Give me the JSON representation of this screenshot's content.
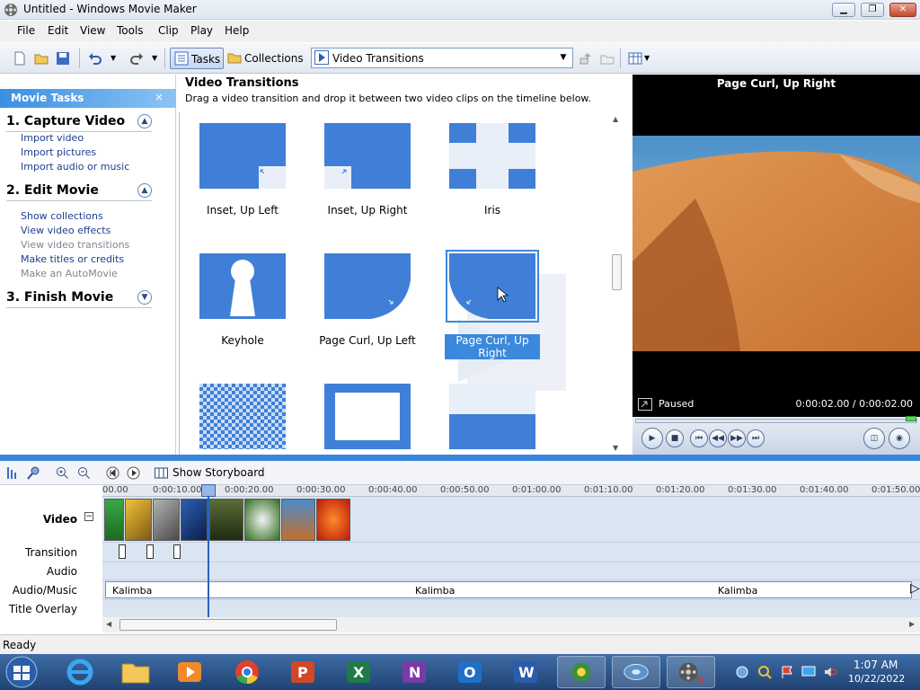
{
  "window": {
    "title": "Untitled - Windows Movie Maker"
  },
  "menu": [
    "File",
    "Edit",
    "View",
    "Tools",
    "Clip",
    "Play",
    "Help"
  ],
  "toolbar": {
    "tasks_label": "Tasks",
    "collections_label": "Collections",
    "collection_value": "Video Transitions"
  },
  "tasks_pane": {
    "header": "Movie Tasks",
    "close": "×",
    "sections": [
      {
        "title": "1. Capture Video",
        "links": [
          "Import video",
          "Import pictures",
          "Import audio or music"
        ]
      },
      {
        "title": "2. Edit Movie",
        "links": [
          "Show collections",
          "View video effects",
          "View video transitions",
          "Make titles or credits",
          "Make an AutoMovie"
        ]
      },
      {
        "title": "3. Finish Movie",
        "links": []
      }
    ]
  },
  "transitions": {
    "title": "Video Transitions",
    "description": "Drag a video transition and drop it between two video clips on the timeline below.",
    "items": [
      "Inset, Up Left",
      "Inset, Up Right",
      "Iris",
      "Keyhole",
      "Page Curl, Up Left",
      "Page Curl, Up Right"
    ],
    "selected": "Page Curl, Up Right"
  },
  "preview": {
    "title": "Page Curl, Up Right",
    "status": "Paused",
    "time": "0:00:02.00 / 0:00:02.00"
  },
  "timeline": {
    "show_storyboard": "Show Storyboard",
    "ruler_ticks": [
      "00.00",
      "0:00:10.00",
      "0:00:20.00",
      "0:00:30.00",
      "0:00:40.00",
      "0:00:50.00",
      "0:01:00.00",
      "0:01:10.00",
      "0:01:20.00",
      "0:01:30.00",
      "0:01:40.00",
      "0:01:50.00"
    ],
    "tracks": [
      "Video",
      "Transition",
      "Audio",
      "Audio/Music",
      "Title Overlay"
    ],
    "music_clip": "Kalimba"
  },
  "statusbar": {
    "text": "Ready"
  },
  "taskbar": {
    "time": "1:07 AM",
    "date": "10/22/2022"
  },
  "colors": {
    "accent": "#3a86de",
    "tile": "#3f7fd8",
    "link": "#1d3e8c"
  }
}
